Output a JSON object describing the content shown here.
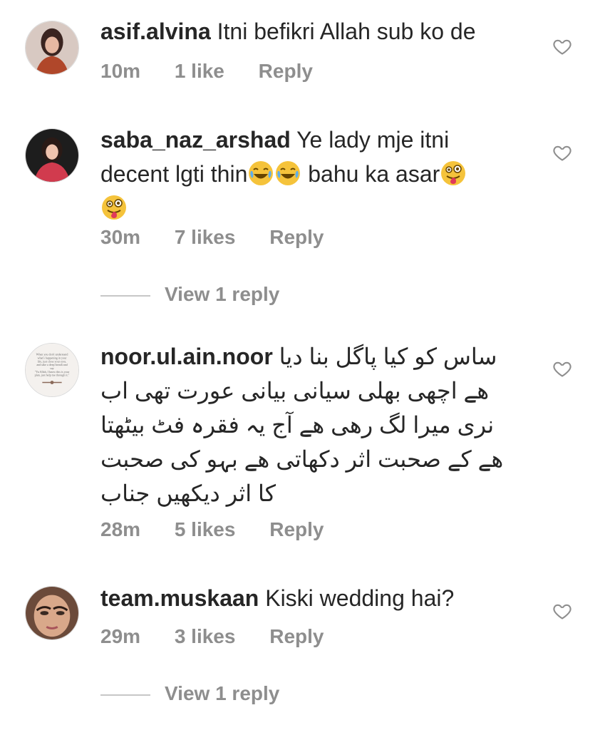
{
  "comments": [
    {
      "username": "asif.alvina",
      "text": "Itni befikri Allah sub ko de",
      "time": "10m",
      "likes": "1 like",
      "reply": "Reply"
    },
    {
      "username": "saba_naz_arshad",
      "text_a": "Ye lady mje itni decent lgti thin",
      "text_b": " bahu ka asar",
      "time": "30m",
      "likes": "7 likes",
      "reply": "Reply",
      "view_replies": "View 1 reply"
    },
    {
      "username": "noor.ul.ain.noor",
      "text": "ساس کو کیا پاگل بنا دیا هے اچھی بھلی سیانی بیانی عورت تھی اب نری میرا لگ رهی هے آج یہ فقرہ فٹ بیٹھتا هے کے صحبت اثر دکھاتی هے بہو کی صحبت کا اثر دیکھیں جناب",
      "time": "28m",
      "likes": "5 likes",
      "reply": "Reply",
      "avatar_text": "When you don't understand what's happening in your life, just close your eyes, and take a deep breath and say \"Ya Allah, I know this is your plan, just help me through it.\""
    },
    {
      "username": "team.muskaan",
      "text": "Kiski wedding hai?",
      "time": "29m",
      "likes": "3 likes",
      "reply": "Reply",
      "view_replies": "View 1 reply"
    }
  ],
  "icons": {
    "like": "heart-outline-icon",
    "laugh_emoji": "face-with-tears-of-joy",
    "wink_emoji": "winking-face-with-tongue"
  },
  "colors": {
    "text": "#262626",
    "secondary": "#8e8e8e",
    "divider": "#c7c7c7"
  }
}
